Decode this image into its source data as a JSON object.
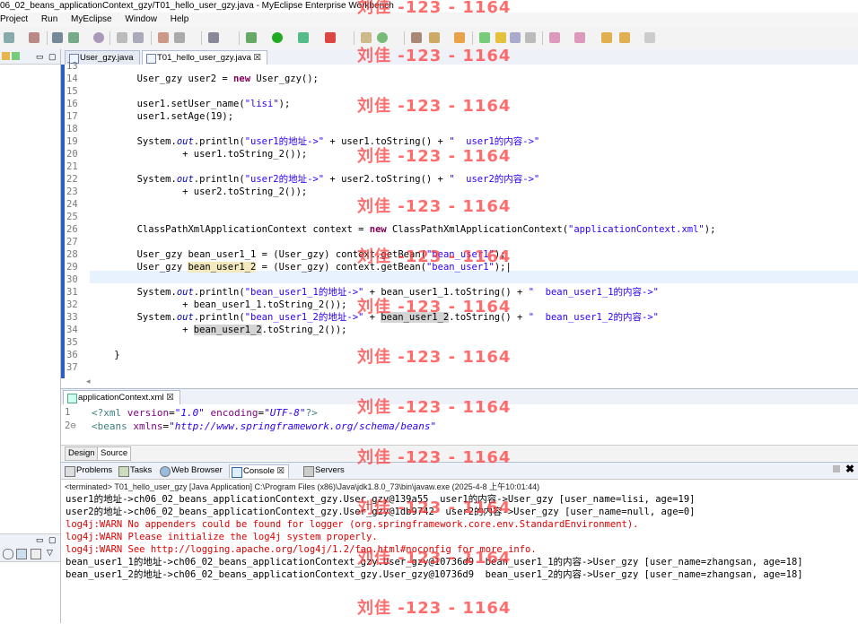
{
  "window": {
    "title": "06_02_beans_applicationContext_gzy/T01_hello_user_gzy.java - MyEclipse Enterprise Workbench"
  },
  "menu": [
    "Project",
    "Run",
    "MyEclipse",
    "Window",
    "Help"
  ],
  "editor": {
    "tabs": [
      {
        "label": "User_gzy.java"
      },
      {
        "label": "T01_hello_user_gzy.java ☒"
      }
    ],
    "lines": [
      {
        "num": "13",
        "html": ""
      },
      {
        "num": "14",
        "html": "        User_gzy user2 = <span class=\"kw\">new</span> User_gzy();"
      },
      {
        "num": "15",
        "html": ""
      },
      {
        "num": "16",
        "html": "        user1.setUser_name(<span class=\"st\">\"lisi\"</span>);"
      },
      {
        "num": "17",
        "html": "        user1.setAge(19);"
      },
      {
        "num": "18",
        "html": ""
      },
      {
        "num": "19",
        "html": "        System.<span class=\"fi\">out</span>.println(<span class=\"st\">\"user1的地址->\"</span> + user1.toString() + <span class=\"st\">\"  user1的内容->\"</span>"
      },
      {
        "num": "20",
        "html": "                + user1.toString_2());"
      },
      {
        "num": "21",
        "html": ""
      },
      {
        "num": "22",
        "html": "        System.<span class=\"fi\">out</span>.println(<span class=\"st\">\"user2的地址->\"</span> + user2.toString() + <span class=\"st\">\"  user2的内容->\"</span>"
      },
      {
        "num": "23",
        "html": "                + user2.toString_2());"
      },
      {
        "num": "24",
        "html": ""
      },
      {
        "num": "25",
        "html": ""
      },
      {
        "num": "26",
        "html": "        ClassPathXmlApplicationContext context = <span class=\"kw\">new</span> ClassPathXmlApplicationContext(<span class=\"st\">\"applicationContext.xml\"</span>);"
      },
      {
        "num": "27",
        "html": ""
      },
      {
        "num": "28",
        "html": "        User_gzy bean_user1_1 = (User_gzy) context.getBean(<span class=\"st\">\"bean_user1\"</span>);"
      },
      {
        "num": "29",
        "html": "        User_gzy <span class=\"hlw\">bean_user1_2</span> = (User_gzy) context.getBean(<span class=\"st\">\"bean_user1\"</span>);|"
      },
      {
        "num": "30",
        "html": ""
      },
      {
        "num": "31",
        "html": "        System.<span class=\"fi\">out</span>.println(<span class=\"st\">\"bean_user1_1的地址->\"</span> + bean_user1_1.toString() + <span class=\"st\">\"  bean_user1_1的内容->\"</span>"
      },
      {
        "num": "32",
        "html": "                + bean_user1_1.toString_2());"
      },
      {
        "num": "33",
        "html": "        System.<span class=\"fi\">out</span>.println(<span class=\"st\">\"bean_user1_2的地址->\"</span> + <span class=\"hl\">bean_user1_2</span>.toString() + <span class=\"st\">\"  bean_user1_2的内容->\"</span>"
      },
      {
        "num": "34",
        "html": "                + <span class=\"hl\">bean_user1_2</span>.toString_2());"
      },
      {
        "num": "35",
        "html": ""
      },
      {
        "num": "36",
        "html": "    }"
      },
      {
        "num": "37",
        "html": ""
      }
    ]
  },
  "xml_editor": {
    "tab": "applicationContext.xml ☒",
    "lines": [
      {
        "num": "1",
        "html": "<span class=\"xt\">&lt;?xml</span> <span class=\"xa\">version</span>=<span class=\"xv\">\"1.0\"</span> <span class=\"xa\">encoding</span>=<span class=\"xv\">\"UTF-8\"</span><span class=\"xt\">?&gt;</span>"
      },
      {
        "num": "2⊖",
        "html": "<span class=\"xt\">&lt;beans</span> <span class=\"xa\">xmlns</span>=<span class=\"xv\">\"http://www.springframework.org/schema/beans\"</span>"
      }
    ],
    "bottom_tabs": [
      "Design",
      "Source"
    ]
  },
  "console": {
    "tabs": [
      "Problems",
      "Tasks",
      "Web Browser",
      "Console ☒",
      "Servers"
    ],
    "terminated": "<terminated> T01_hello_user_gzy [Java Application] C:\\Program Files (x86)\\Java\\jdk1.8.0_73\\bin\\javaw.exe (2025-4-8 上午10:01:44)",
    "lines": [
      {
        "text": "user1的地址->ch06_02_beans_applicationContext_gzy.User_gzy@139a55  user1的内容->User_gzy [user_name=lisi, age=19]",
        "type": "out"
      },
      {
        "text": "user2的地址->ch06_02_beans_applicationContext_gzy.User_gzy@1db9742  user2的内容->User_gzy [user_name=null, age=0]",
        "type": "out"
      },
      {
        "text": "log4j:WARN No appenders could be found for logger (org.springframework.core.env.StandardEnvironment).",
        "type": "err"
      },
      {
        "text": "log4j:WARN Please initialize the log4j system properly.",
        "type": "err"
      },
      {
        "text": "log4j:WARN See http://logging.apache.org/log4j/1.2/faq.html#noconfig for more info.",
        "type": "err"
      },
      {
        "text": "bean_user1_1的地址->ch06_02_beans_applicationContext_gzy.User_gzy@10736d9  bean_user1_1的内容->User_gzy [user_name=zhangsan, age=18]",
        "type": "out"
      },
      {
        "text": "bean_user1_2的地址->ch06_02_beans_applicationContext_gzy.User_gzy@10736d9  bean_user1_2的内容->User_gzy [user_name=zhangsan, age=18]",
        "type": "out"
      }
    ]
  },
  "watermark": "刘佳 -123 - 1164"
}
